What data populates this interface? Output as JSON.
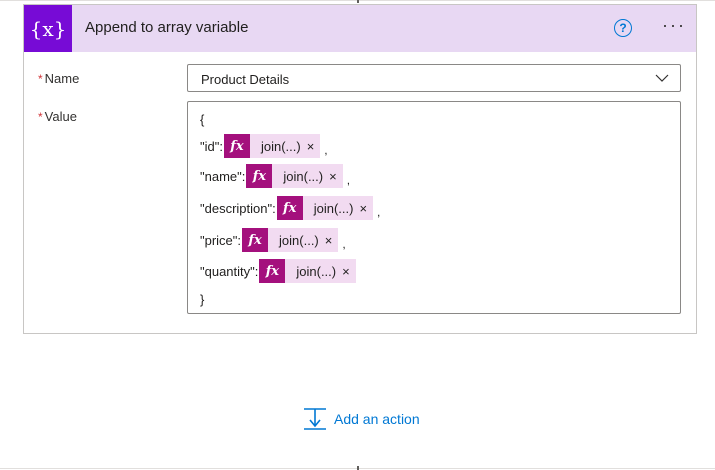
{
  "action_card": {
    "icon_text": "{x}",
    "title": "Append to array variable",
    "help_glyph": "?",
    "more_glyph": "···",
    "header_color": "#e8d8f3",
    "icon_color": "#770bd6"
  },
  "fields": {
    "name": {
      "required_marker": "*",
      "label": "Name",
      "value": "Product Details"
    },
    "value": {
      "required_marker": "*",
      "label": "Value",
      "open_brace": "{",
      "close_brace": "}",
      "lines": [
        {
          "key": "\"id\":",
          "token_icon": "fx",
          "token_text": "join(...)",
          "remove_glyph": "×",
          "trailing": ","
        },
        {
          "key": "\"name\":",
          "token_icon": "fx",
          "token_text": "join(...)",
          "remove_glyph": "×",
          "trailing": ","
        },
        {
          "key": "\"description\":",
          "token_icon": "fx",
          "token_text": "join(...)",
          "remove_glyph": "×",
          "trailing": ","
        },
        {
          "key": "\"price\":",
          "token_icon": "fx",
          "token_text": "join(...)",
          "remove_glyph": "×",
          "trailing": ","
        },
        {
          "key": "\"quantity\":",
          "token_icon": "fx",
          "token_text": "join(...)",
          "remove_glyph": "×",
          "trailing": ""
        }
      ]
    }
  },
  "add_action": {
    "label": "Add an action",
    "color": "#0078d4"
  }
}
